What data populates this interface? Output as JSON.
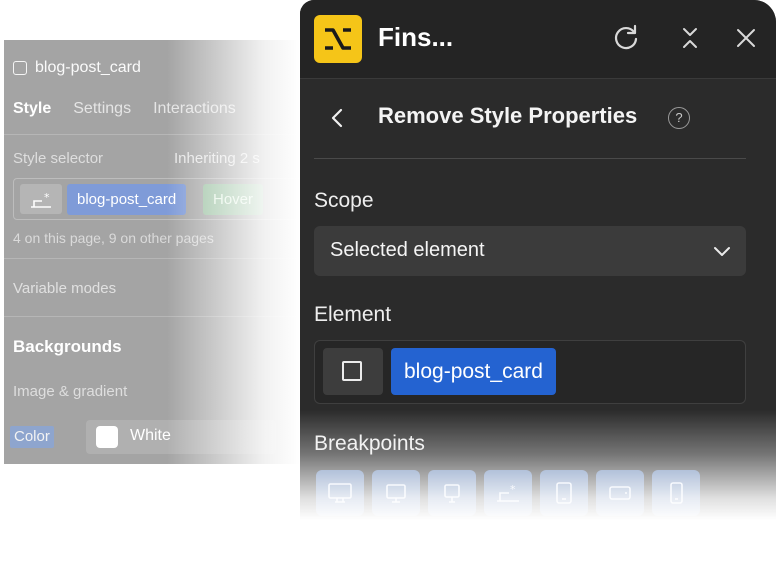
{
  "left_panel": {
    "element_name": "blog-post_card",
    "tabs": [
      {
        "label": "Style",
        "active": true
      },
      {
        "label": "Settings",
        "active": false
      },
      {
        "label": "Interactions",
        "active": false
      }
    ],
    "style_selector_label": "Style selector",
    "inheriting_text": "Inheriting 2 s",
    "selector_chip": "blog-post_card",
    "state_chip": "Hover",
    "usage_text": "4 on this page, 9 on other pages",
    "variable_modes_label": "Variable modes",
    "backgrounds_heading": "Backgrounds",
    "image_gradient_label": "Image & gradient",
    "color_label": "Color",
    "color_value": "White"
  },
  "right_panel": {
    "app_name": "Fins...",
    "logo_color": "#f5c518",
    "header_icons": [
      "refresh-icon",
      "collapse-icon",
      "close-icon"
    ],
    "page_title": "Remove Style Properties",
    "help_symbol": "?",
    "scope_label": "Scope",
    "scope_value": "Selected element",
    "element_label": "Element",
    "element_chip": "blog-post_card",
    "element_chip_color": "#2463d1",
    "breakpoints_label": "Breakpoints",
    "breakpoint_icons": [
      "desktop-large-icon",
      "desktop-icon",
      "desktop-small-icon",
      "desktop-base-icon",
      "tablet-icon",
      "mobile-landscape-icon",
      "mobile-portrait-icon"
    ]
  }
}
